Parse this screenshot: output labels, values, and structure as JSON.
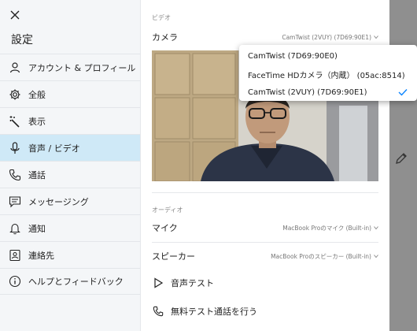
{
  "sidebar": {
    "title": "設定",
    "items": [
      {
        "label": "アカウント & プロフィール",
        "icon": "person-icon"
      },
      {
        "label": "全般",
        "icon": "gear-icon"
      },
      {
        "label": "表示",
        "icon": "magic-wand-icon"
      },
      {
        "label": "音声 / ビデオ",
        "icon": "microphone-icon",
        "active": true
      },
      {
        "label": "通話",
        "icon": "phone-icon"
      },
      {
        "label": "メッセージング",
        "icon": "message-icon"
      },
      {
        "label": "通知",
        "icon": "bell-icon"
      },
      {
        "label": "連絡先",
        "icon": "contacts-icon"
      },
      {
        "label": "ヘルプとフィードバック",
        "icon": "info-icon"
      }
    ]
  },
  "video_section": {
    "label": "ビデオ",
    "camera_label": "カメラ",
    "camera_value": "CamTwist (2VUY) (7D69:90E1)"
  },
  "camera_dropdown": {
    "options": [
      "CamTwist (7D69:90E0)",
      "FaceTime HDカメラ（内蔵） (05ac:8514)",
      "CamTwist (2VUY) (7D69:90E1)"
    ],
    "selected_index": 2
  },
  "audio_section": {
    "label": "オーディオ",
    "mic_label": "マイク",
    "mic_value": "MacBook Proのマイク (Built-in)",
    "speaker_label": "スピーカー",
    "speaker_value": "MacBook Proのスピーカー (Built-in)"
  },
  "actions": {
    "audio_test": "音声テスト",
    "free_test_call": "無料テスト通話を行う"
  },
  "colors": {
    "accent": "#0a84ff",
    "active_bg": "#cfe9f7",
    "sidebar_bg": "#f4f6f8"
  }
}
